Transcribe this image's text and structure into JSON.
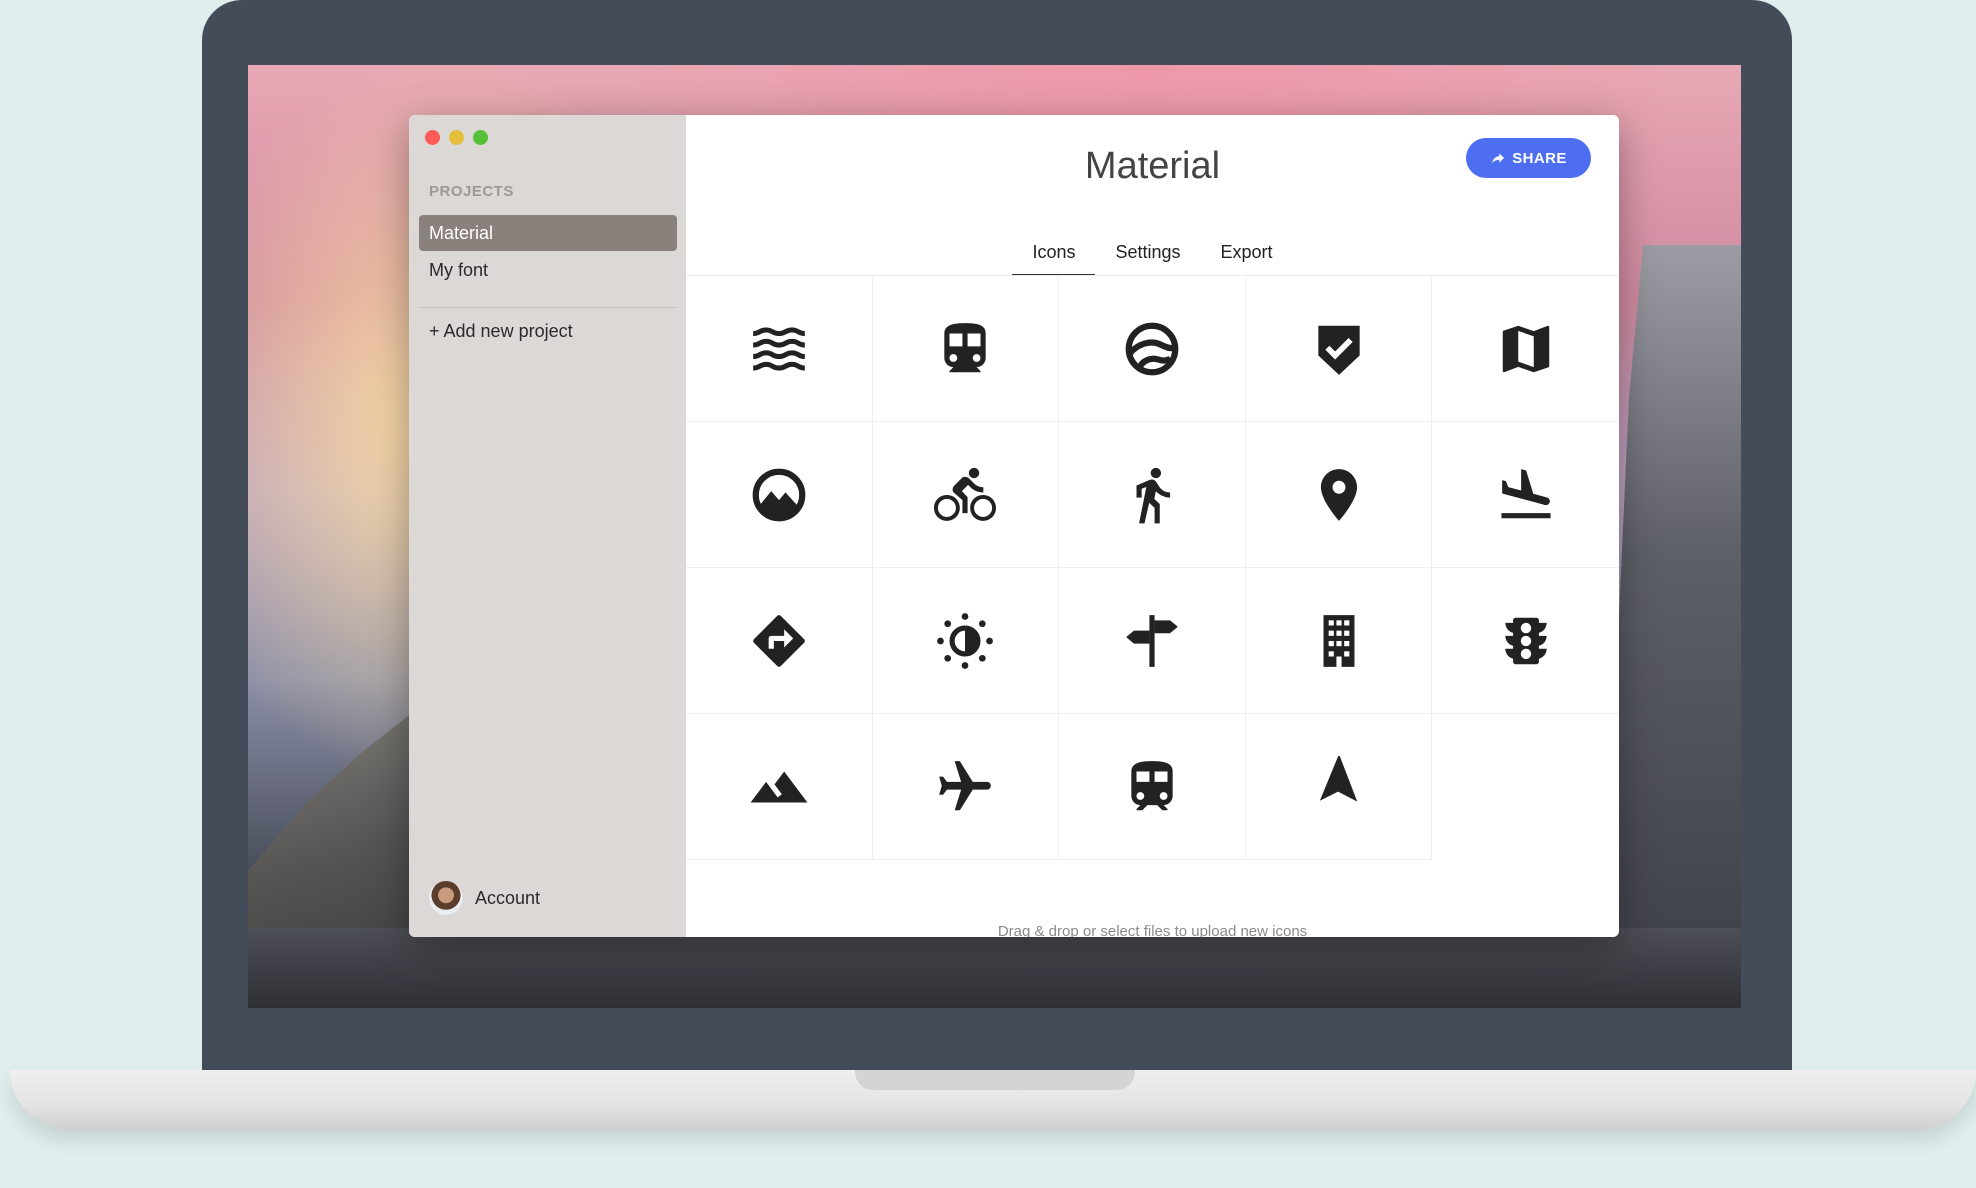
{
  "window": {
    "sidebar": {
      "projects_heading": "PROJECTS",
      "projects": [
        {
          "label": "Material",
          "active": true
        },
        {
          "label": "My font",
          "active": false
        }
      ],
      "add_project_label": "+ Add new project",
      "account_label": "Account"
    },
    "header": {
      "title": "Material",
      "share_label": "SHARE"
    },
    "tabs": [
      {
        "label": "Icons",
        "active": true
      },
      {
        "label": "Settings",
        "active": false
      },
      {
        "label": "Export",
        "active": false
      }
    ],
    "icons": [
      "waves-icon",
      "subway-icon",
      "google-earth-icon",
      "verified-shield-icon",
      "map-icon",
      "landscape-circle-icon",
      "bike-icon",
      "walk-icon",
      "place-icon",
      "flight-land-icon",
      "directions-icon",
      "brightness-icon",
      "signpost-icon",
      "building-icon",
      "traffic-light-icon",
      "terrain-icon",
      "flight-icon",
      "train-icon",
      "navigation-icon"
    ],
    "drop_hint": "Drag & drop or select files to upload new icons"
  },
  "colors": {
    "accent": "#4d6ef0",
    "sidebar_bg": "#dcd8d6",
    "active_project": "#8a817c",
    "icon": "#222222"
  }
}
